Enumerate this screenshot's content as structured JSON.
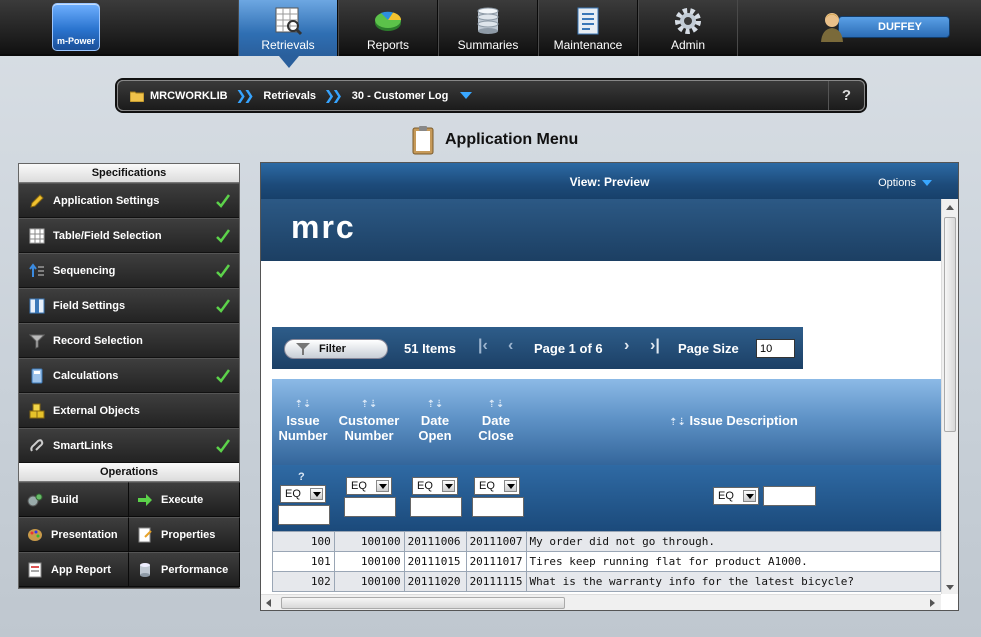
{
  "app": {
    "logo_text": "m-Power",
    "user": "DUFFEY",
    "nav": [
      {
        "label": "Retrievals",
        "icon": "report-grid-icon",
        "active": true
      },
      {
        "label": "Reports",
        "icon": "pie-chart-icon",
        "active": false
      },
      {
        "label": "Summaries",
        "icon": "database-icon",
        "active": false
      },
      {
        "label": "Maintenance",
        "icon": "document-list-icon",
        "active": false
      },
      {
        "label": "Admin",
        "icon": "gear-icon",
        "active": false
      }
    ]
  },
  "breadcrumb": {
    "library": "MRCWORKLIB",
    "section": "Retrievals",
    "app": "30 - Customer Log",
    "help": "?"
  },
  "page_title": "Application Menu",
  "specifications": {
    "header": "Specifications",
    "items": [
      {
        "label": "Application Settings",
        "icon": "pencil-icon",
        "done": true
      },
      {
        "label": "Table/Field Selection",
        "icon": "table-icon",
        "done": true
      },
      {
        "label": "Sequencing",
        "icon": "sort-arrows-icon",
        "done": true
      },
      {
        "label": "Field Settings",
        "icon": "field-columns-icon",
        "done": true
      },
      {
        "label": "Record Selection",
        "icon": "funnel-icon",
        "done": false
      },
      {
        "label": "Calculations",
        "icon": "calculator-icon",
        "done": true
      },
      {
        "label": "External Objects",
        "icon": "cubes-icon",
        "done": false
      },
      {
        "label": "SmartLinks",
        "icon": "link-icon",
        "done": true
      }
    ]
  },
  "operations": {
    "header": "Operations",
    "items": [
      {
        "label": "Build",
        "icon": "build-gears-icon"
      },
      {
        "label": "Execute",
        "icon": "arrow-right-icon"
      },
      {
        "label": "Presentation",
        "icon": "palette-icon"
      },
      {
        "label": "Properties",
        "icon": "properties-icon"
      },
      {
        "label": "App Report",
        "icon": "report-icon"
      },
      {
        "label": "Performance",
        "icon": "database-icon"
      }
    ]
  },
  "preview": {
    "view_title": "View: Preview",
    "options_label": "Options",
    "banner": "mrc",
    "filter_label": "Filter",
    "items_count": "51 Items",
    "page_info": "Page 1 of 6",
    "page_size_label": "Page Size",
    "page_size_value": "10",
    "first_icon": "first-page-icon",
    "prev_icon": "prev-page-icon",
    "next_icon": "next-page-icon",
    "last_icon": "last-page-icon"
  },
  "grid": {
    "columns": [
      "Issue Number",
      "Customer Number",
      "Date Open",
      "Date Close",
      "Issue Description"
    ],
    "sort_glyph": "⇡⇣",
    "help_glyph": "?",
    "operator": "EQ",
    "rows": [
      {
        "issue": "100",
        "customer": "100100",
        "open": "20111006",
        "close": "20111007",
        "desc": "My order did not go through."
      },
      {
        "issue": "101",
        "customer": "100100",
        "open": "20111015",
        "close": "20111017",
        "desc": "Tires keep running flat for product A1000."
      },
      {
        "issue": "102",
        "customer": "100100",
        "open": "20111020",
        "close": "20111115",
        "desc": "What is the warranty info for the latest bicycle?"
      }
    ]
  }
}
